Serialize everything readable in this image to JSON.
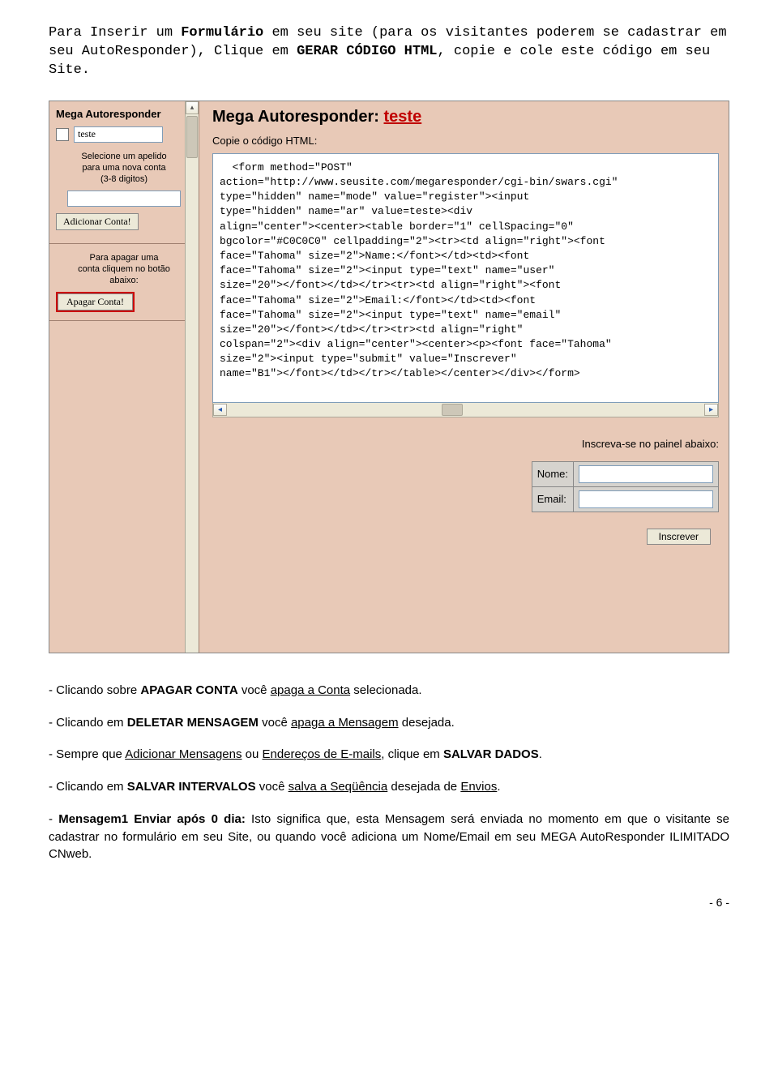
{
  "intro": {
    "pre": "Para Inserir um ",
    "bold1": "Formulário",
    "mid1": " em seu site (para os visitantes poderem se cadastrar em seu AutoResponder), Clique em ",
    "bold2": "GERAR CÓDIGO HTML",
    "mid2": ", copie e cole este código em seu Site."
  },
  "sidebar": {
    "title": "Mega Autoresponder",
    "item_value": "teste",
    "help1a": "Selecione um apelido",
    "help1b": "para uma nova conta",
    "help1c": "(3-8 digitos)",
    "add_btn": "Adicionar Conta!",
    "help2a": "Para apagar uma",
    "help2b": "conta cliquem no botão",
    "help2c": "abaixo:",
    "del_btn": "Apagar Conta!"
  },
  "main": {
    "title_pre": "Mega Autoresponder: ",
    "title_red": "teste",
    "copy_label": "Copie o código HTML:",
    "code": "  <form method=\"POST\"\naction=\"http://www.seusite.com/megaresponder/cgi-bin/swars.cgi\"\ntype=\"hidden\" name=\"mode\" value=\"register\"><input\ntype=\"hidden\" name=\"ar\" value=teste><div\nalign=\"center\"><center><table border=\"1\" cellSpacing=\"0\"\nbgcolor=\"#C0C0C0\" cellpadding=\"2\"><tr><td align=\"right\"><font\nface=\"Tahoma\" size=\"2\">Name:</font></td><td><font\nface=\"Tahoma\" size=\"2\"><input type=\"text\" name=\"user\"\nsize=\"20\"></font></td></tr><tr><td align=\"right\"><font\nface=\"Tahoma\" size=\"2\">Email:</font></td><td><font\nface=\"Tahoma\" size=\"2\"><input type=\"text\" name=\"email\"\nsize=\"20\"></font></td></tr><tr><td align=\"right\"\ncolspan=\"2\"><div align=\"center\"><center><p><font face=\"Tahoma\"\nsize=\"2\"><input type=\"submit\" value=\"Inscrever\"\nname=\"B1\"></font></td></tr></table></center></div></form>",
    "subscribe_prompt": "Inscreva-se no painel abaixo:",
    "nome_lbl": "Nome:",
    "email_lbl": "Email:",
    "subscribe_btn": "Inscrever"
  },
  "below": {
    "p1a": "- Clicando sobre ",
    "p1b": "APAGAR CONTA",
    "p1c": " você ",
    "p1d": "apaga a Conta",
    "p1e": " selecionada.",
    "p2a": "- Clicando em ",
    "p2b": "DELETAR MENSAGEM",
    "p2c": " você ",
    "p2d": "apaga a Mensagem",
    "p2e": " desejada.",
    "p3a": "- Sempre que ",
    "p3b": "Adicionar Mensagens",
    "p3c": " ou ",
    "p3d": "Endereços de E-mails",
    "p3e": ", clique em ",
    "p3f": "SALVAR DADOS",
    "p3g": ".",
    "p4a": "- Clicando em ",
    "p4b": "SALVAR INTERVALOS",
    "p4c": " você ",
    "p4d": "salva a Seqüência",
    "p4e": " desejada de ",
    "p4f": "Envios",
    "p4g": ".",
    "p5a": "- ",
    "p5b": "Mensagem1 Enviar após 0 dia:",
    "p5c": " Isto significa que, esta Mensagem será enviada no momento em que o visitante se cadastrar no formulário em seu Site, ou quando você adiciona um Nome/Email em seu MEGA AutoResponder ILIMITADO CNweb."
  },
  "page_num": "- 6 -"
}
